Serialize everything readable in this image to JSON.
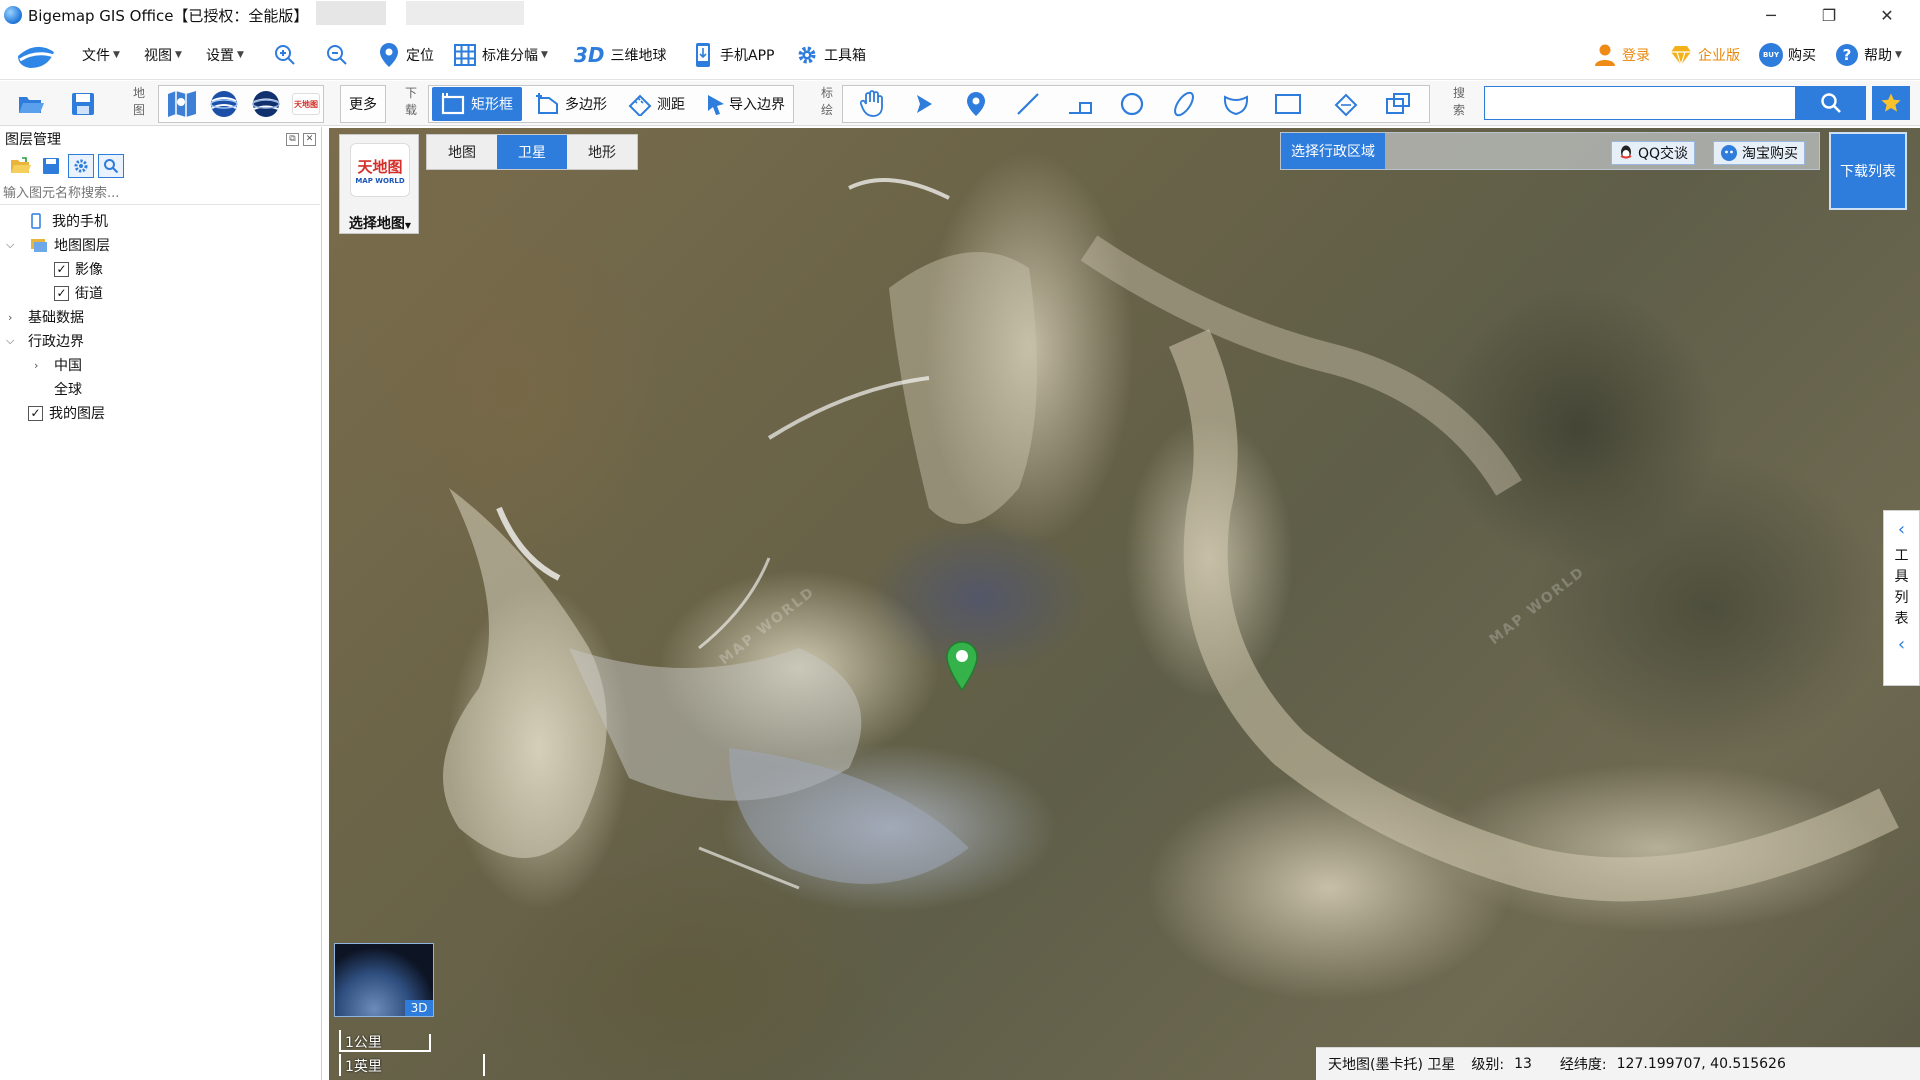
{
  "window": {
    "title": "Bigemap GIS Office【已授权：全能版】",
    "minimize_glyph": "─",
    "restore_glyph": "❐",
    "close_glyph": "✕"
  },
  "menu": {
    "file": "文件",
    "view": "视图",
    "settings": "设置",
    "locate": "定位",
    "sheet": "标准分幅",
    "threed_prefix": "3D",
    "globe": "三维地球",
    "mobile": "手机APP",
    "toolbox": "工具箱",
    "login": "登录",
    "enterprise": "企业版",
    "buy_badge": "BUY",
    "buy": "购买",
    "help": "帮助"
  },
  "toolbar2": {
    "map_vlabel": [
      "地",
      "图"
    ],
    "more": "更多",
    "download_vlabel": [
      "下",
      "载"
    ],
    "rect": "矩形框",
    "polygon": "多边形",
    "measure": "测距",
    "import_border": "导入边界",
    "mark_vlabel": [
      "标",
      "绘"
    ],
    "search_vlabel": [
      "搜",
      "索"
    ],
    "search_value": ""
  },
  "left_panel": {
    "title": "图层管理",
    "search_placeholder": "输入图元名称搜索...",
    "tree": {
      "my_phone": "我的手机",
      "map_layers": "地图图层",
      "imagery": "影像",
      "streets": "街道",
      "base_data": "基础数据",
      "admin_border": "行政边界",
      "china": "中国",
      "global": "全球",
      "my_layers": "我的图层"
    }
  },
  "map": {
    "selector_logo_cn": "天地图",
    "selector_logo_en": "MAP WORLD",
    "selector_label": "选择地图",
    "tabs": [
      "地图",
      "卫星",
      "地形"
    ],
    "active_tab": "卫星",
    "region_button": "选择行政区域",
    "qq_button": "QQ交谈",
    "taobao_button": "淘宝购买",
    "download_list": "下载列表",
    "right_tab_chars": [
      "工",
      "具",
      "列",
      "表"
    ],
    "watermark": "MAP WORLD",
    "globe_badge": "3D",
    "scale_km": "1公里",
    "scale_mile": "1英里"
  },
  "status": {
    "source": "天地图(墨卡托) 卫星",
    "level_label": "级别:",
    "level_value": "13",
    "coord_label": "经纬度:",
    "coord_value": "127.199707, 40.515626"
  },
  "colors": {
    "accent": "#2e7cdb",
    "marker": "#35b24a",
    "orange": "#e7890b"
  }
}
